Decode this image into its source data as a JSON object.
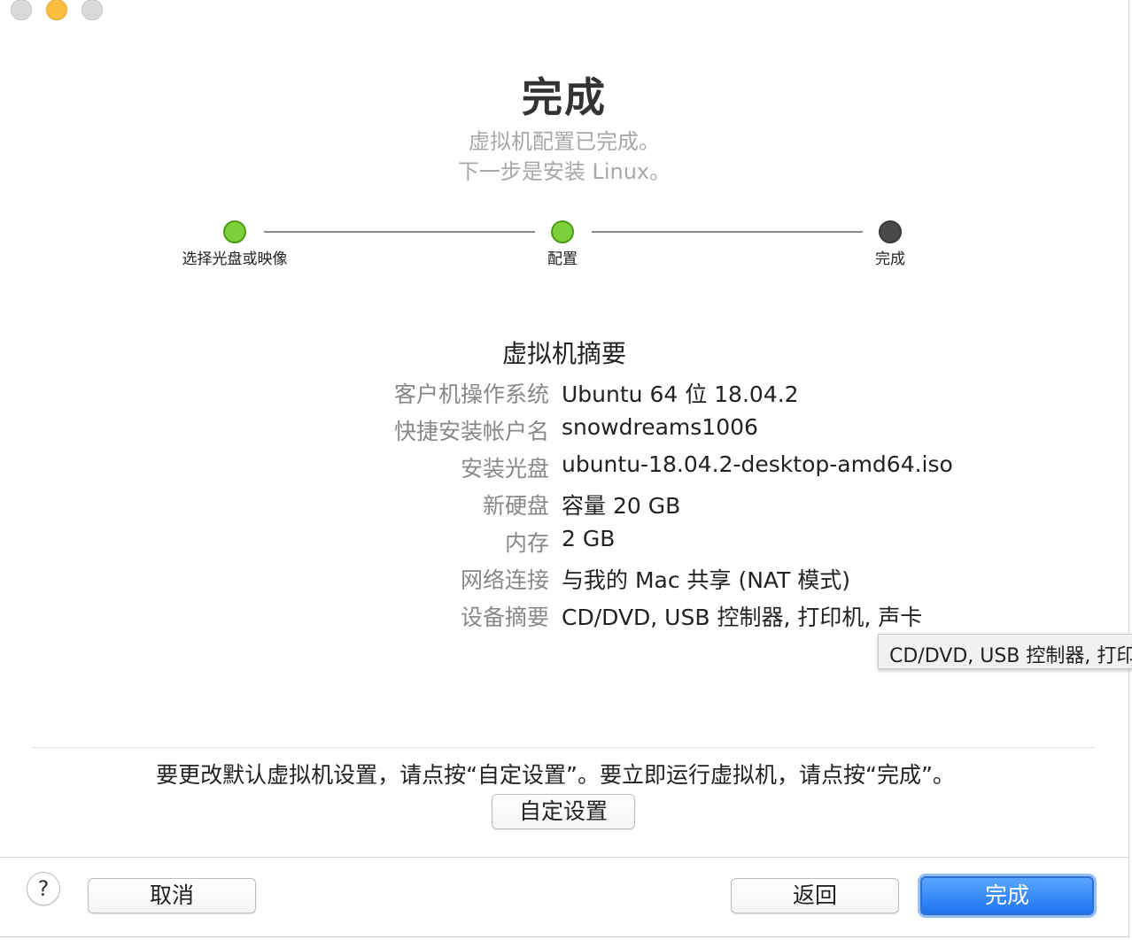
{
  "window": {
    "title": "完成",
    "subtitle_line1": "虚拟机配置已完成。",
    "subtitle_line2": "下一步是安装 Linux。"
  },
  "steps": [
    {
      "label": "选择光盘或映像",
      "status": "done"
    },
    {
      "label": "配置",
      "status": "done"
    },
    {
      "label": "完成",
      "status": "current"
    }
  ],
  "summary": {
    "title": "虚拟机摘要",
    "rows": [
      {
        "label": "客户机操作系统",
        "value": "Ubuntu 64 位 18.04.2"
      },
      {
        "label": "快捷安装帐户名",
        "value": "snowdreams1006"
      },
      {
        "label": "安装光盘",
        "value": "ubuntu-18.04.2-desktop-amd64.iso"
      },
      {
        "label": "新硬盘",
        "value": "容量 20 GB"
      },
      {
        "label": "内存",
        "value": "2 GB"
      },
      {
        "label": "网络连接",
        "value": "与我的 Mac 共享 (NAT 模式)"
      },
      {
        "label": "设备摘要",
        "value": "CD/DVD, USB 控制器, 打印机, 声卡"
      }
    ]
  },
  "tooltip": {
    "text": "CD/DVD, USB 控制器, 打印"
  },
  "hint": "要更改默认虚拟机设置，请点按“自定设置”。要立即运行虚拟机，请点按“完成”。",
  "buttons": {
    "customize": "自定设置",
    "help": "?",
    "cancel": "取消",
    "back": "返回",
    "done": "完成"
  },
  "colors": {
    "step_done": "#7ed03b",
    "step_current": "#4a4a4a",
    "primary_button": "#1f74f0",
    "traffic_minimize": "#fdbd41"
  }
}
